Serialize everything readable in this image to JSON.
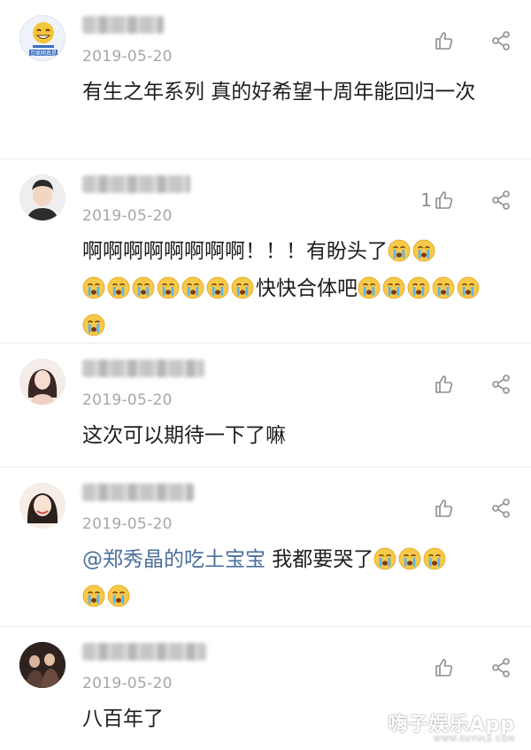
{
  "comments": [
    {
      "date": "2019-05-20",
      "like_count": "",
      "text": "有生之年系列 真的好希望十周年能回归一次",
      "avatar_text": "互联网真是"
    },
    {
      "date": "2019-05-20",
      "like_count": "1",
      "line1": "啊啊啊啊啊啊啊啊！！！有盼头了",
      "line2": "快快合体吧"
    },
    {
      "date": "2019-05-20",
      "like_count": "",
      "text": "这次可以期待一下了嘛"
    },
    {
      "date": "2019-05-20",
      "like_count": "",
      "mention": "@郑秀晶的吃土宝宝",
      "text": " 我都要哭了"
    },
    {
      "date": "2019-05-20",
      "like_count": "",
      "text": "八百年了"
    }
  ],
  "icons": {
    "like": "thumbs-up-icon",
    "share": "share-icon",
    "emoji": "crying-emoji-icon"
  },
  "colors": {
    "date": "#a7a7a7",
    "mention": "#4a6f9b",
    "icon": "#8d8d8d"
  },
  "watermark": {
    "main": "嗨子娱乐App",
    "sub": "WWW.KUYULE.COM"
  }
}
